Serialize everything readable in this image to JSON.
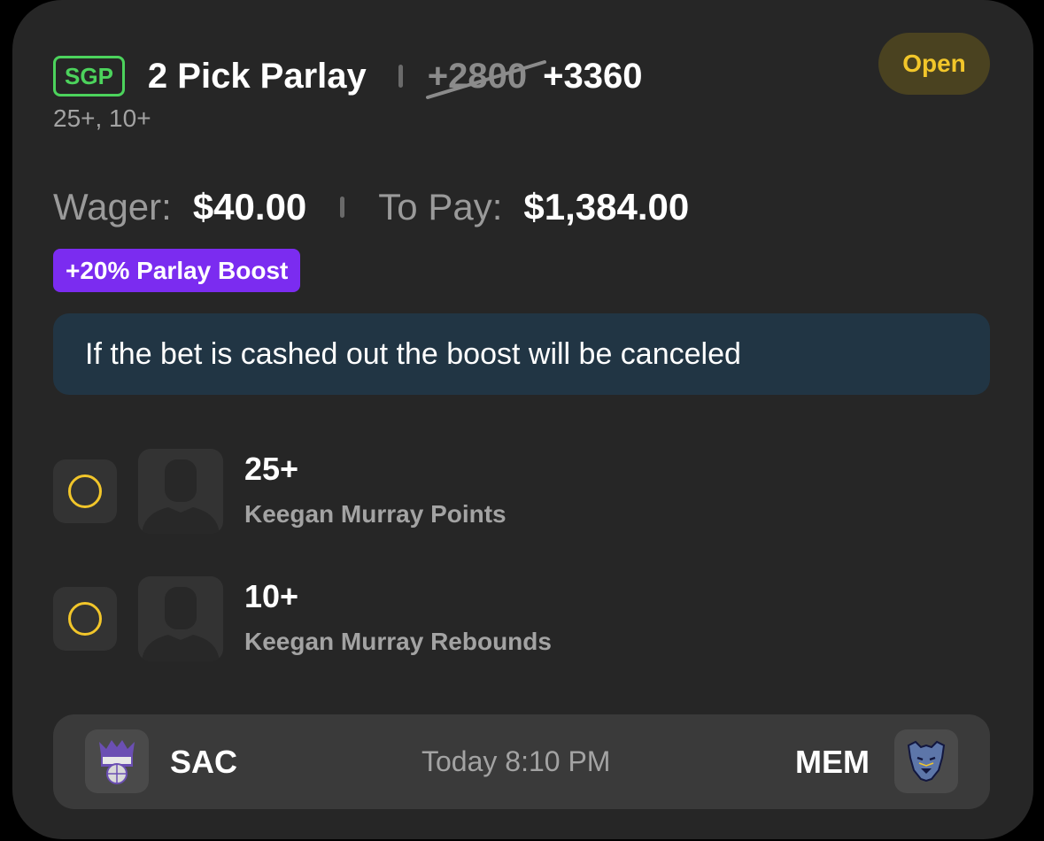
{
  "bet": {
    "tag": "SGP",
    "title": "2 Pick Parlay",
    "original_odds": "+2800",
    "boosted_odds": "+3360",
    "summary": "25+, 10+",
    "status": "Open"
  },
  "amounts": {
    "wager_label": "Wager:",
    "wager_value": "$40.00",
    "to_pay_label": "To Pay:",
    "to_pay_value": "$1,384.00"
  },
  "boost": {
    "label": "+20% Parlay Boost"
  },
  "notice": {
    "text": "If the bet is cashed out the boost will be canceled"
  },
  "legs": [
    {
      "line": "25+",
      "market": "Keegan Murray Points",
      "status_icon": "pending-ring-icon"
    },
    {
      "line": "10+",
      "market": "Keegan Murray Rebounds",
      "status_icon": "pending-ring-icon"
    }
  ],
  "game": {
    "home_abbr": "SAC",
    "home_logo": "kings-logo-icon",
    "time": "Today 8:10 PM",
    "away_abbr": "MEM",
    "away_logo": "grizzlies-logo-icon"
  },
  "colors": {
    "card_bg": "#262626",
    "sgp_green": "#4cd35c",
    "status_yellow": "#f2c62a",
    "boost_purple": "#7b2cf0",
    "notice_bg": "#213544"
  }
}
